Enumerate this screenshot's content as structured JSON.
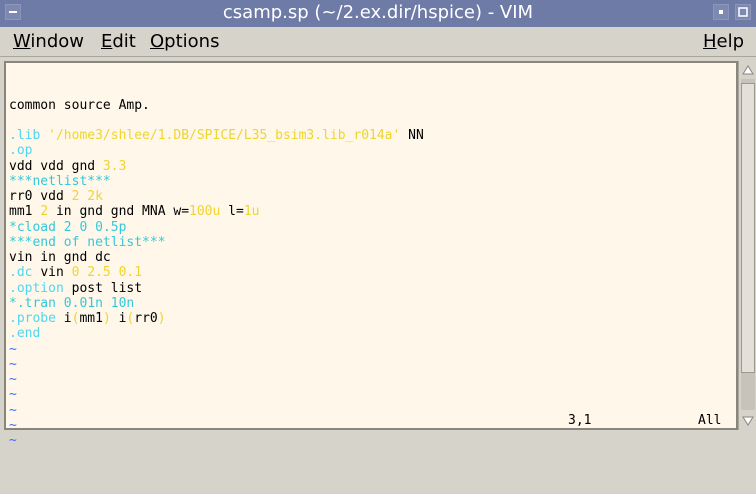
{
  "window": {
    "title": "csamp.sp (~/2.ex.dir/hspice) - VIM",
    "menu_icon": "window-menu-icon",
    "buttons": [
      "minimize-icon",
      "maximize-icon"
    ]
  },
  "menubar": {
    "window": {
      "accel": "W",
      "rest": "indow"
    },
    "edit": {
      "accel": "E",
      "rest": "dit"
    },
    "options": {
      "accel": "O",
      "rest": "ptions"
    },
    "help": {
      "accel": "H",
      "rest": "elp"
    }
  },
  "editor": {
    "lines": [
      [
        {
          "t": "common source Amp.",
          "c": ""
        }
      ],
      [
        {
          "t": "",
          "c": ""
        }
      ],
      [
        {
          "t": ".lib ",
          "c": "cy"
        },
        {
          "t": "'/home3/shlee/1.DB/SPICE/L35_bsim3.lib_r014a'",
          "c": "yl"
        },
        {
          "t": " NN",
          "c": ""
        }
      ],
      [
        {
          "t": ".op",
          "c": "cy"
        }
      ],
      [
        {
          "t": "vdd vdd gnd ",
          "c": ""
        },
        {
          "t": "3.3",
          "c": "yl"
        }
      ],
      [
        {
          "t": "***netlist***",
          "c": "tl"
        }
      ],
      [
        {
          "t": "rr0 vdd ",
          "c": ""
        },
        {
          "t": "2 2k",
          "c": "yl"
        }
      ],
      [
        {
          "t": "mm1 ",
          "c": ""
        },
        {
          "t": "2",
          "c": "yl"
        },
        {
          "t": " in gnd gnd MNA w=",
          "c": ""
        },
        {
          "t": "100u",
          "c": "yl"
        },
        {
          "t": " l=",
          "c": ""
        },
        {
          "t": "1u",
          "c": "yl"
        }
      ],
      [
        {
          "t": "*cload 2 0 0.5p",
          "c": "tl"
        }
      ],
      [
        {
          "t": "***end of netlist***",
          "c": "tl"
        }
      ],
      [
        {
          "t": "vin in gnd dc",
          "c": ""
        }
      ],
      [
        {
          "t": ".dc ",
          "c": "cy"
        },
        {
          "t": "vin ",
          "c": ""
        },
        {
          "t": "0 2.5 0.1",
          "c": "yl"
        }
      ],
      [
        {
          "t": ".option ",
          "c": "cy"
        },
        {
          "t": "post list",
          "c": ""
        }
      ],
      [
        {
          "t": "*.tran 0.01n 10n",
          "c": "tl"
        }
      ],
      [
        {
          "t": ".probe ",
          "c": "cy"
        },
        {
          "t": "i",
          "c": ""
        },
        {
          "t": "(",
          "c": "yl"
        },
        {
          "t": "mm1",
          "c": ""
        },
        {
          "t": ") ",
          "c": "yl"
        },
        {
          "t": "i",
          "c": ""
        },
        {
          "t": "(",
          "c": "yl"
        },
        {
          "t": "rr0",
          "c": ""
        },
        {
          "t": ")",
          "c": "yl"
        }
      ],
      [
        {
          "t": ".end",
          "c": "cy"
        }
      ]
    ],
    "tilde_lines": 7,
    "tilde_char": "~"
  },
  "statusline": {
    "position": "3,1",
    "scroll": "All"
  },
  "colors": {
    "background": "#fff7e9",
    "keyword": "#4fd7f0",
    "value": "#f0d52c",
    "comment": "#33c9d9",
    "tilde": "#3a6dff"
  }
}
